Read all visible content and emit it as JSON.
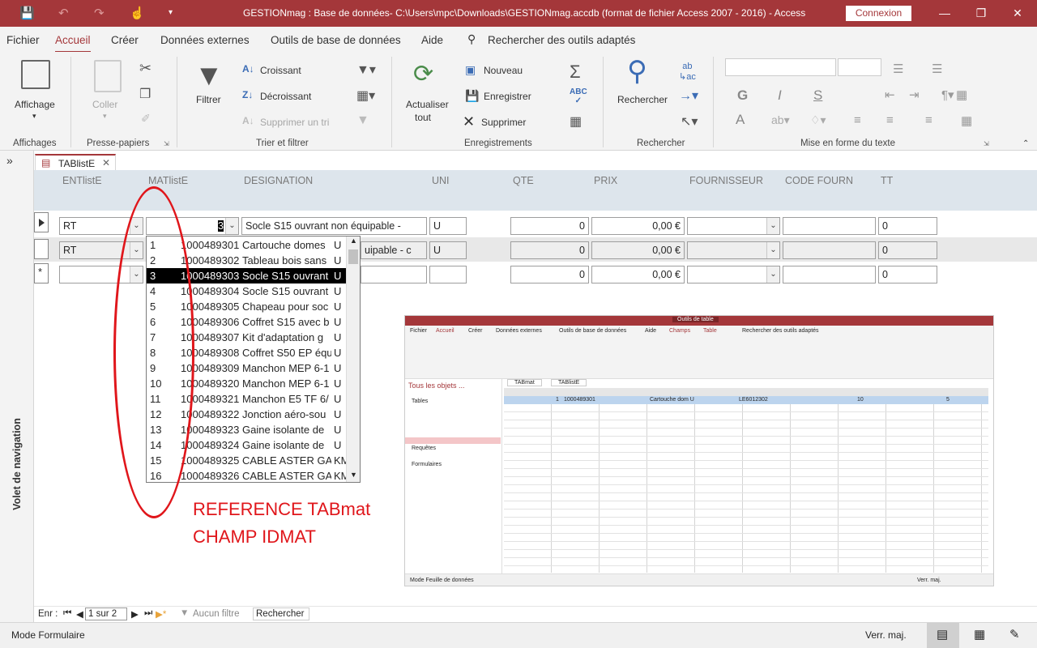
{
  "window": {
    "title": "GESTIONmag : Base de données- C:\\Users\\mpc\\Downloads\\GESTIONmag.accdb (format de fichier Access 2007 - 2016)  -  Access",
    "connexion": "Connexion"
  },
  "menu": [
    "Fichier",
    "Accueil",
    "Créer",
    "Données externes",
    "Outils de base de données",
    "Aide"
  ],
  "search_tools": "Rechercher des outils adaptés",
  "ribbon": {
    "affichage": "Affichage",
    "coller": "Coller",
    "filtrer": "Filtrer",
    "croissant": "Croissant",
    "decroissant": "Décroissant",
    "supprimer_tri": "Supprimer un tri",
    "actualiser": "Actualiser",
    "tout": "tout",
    "nouveau": "Nouveau",
    "enregistrer": "Enregistrer",
    "supprimer": "Supprimer",
    "rechercher": "Rechercher",
    "g": "G",
    "i": "I",
    "s": "S",
    "a": "A",
    "groups": {
      "affichages": "Affichages",
      "presse_papiers": "Presse-papiers",
      "trier_filtrer": "Trier et filtrer",
      "enregistrements": "Enregistrements",
      "rechercher": "Rechercher",
      "mise_en_forme": "Mise en forme du texte"
    }
  },
  "nav_pane_label": "Volet de navigation",
  "tab": {
    "label": "TABlistE"
  },
  "columns": [
    "ENTlistE",
    "MATlistE",
    "DESIGNATION",
    "UNI",
    "QTE",
    "PRIX",
    "FOURNISSEUR",
    "CODE FOURN",
    "TT"
  ],
  "rows": [
    {
      "ent": "RT",
      "mat": "3",
      "designation": "Socle S15 ouvrant non équipable -",
      "uni": "U",
      "qte": "0",
      "prix": "0,00 €",
      "fournisseur": "",
      "code": "",
      "tt": "0"
    },
    {
      "ent": "RT",
      "mat": "",
      "designation": "uipable - c",
      "uni": "U",
      "qte": "0",
      "prix": "0,00 €",
      "fournisseur": "",
      "code": "",
      "tt": "0"
    },
    {
      "ent": "",
      "mat": "",
      "designation": "",
      "uni": "",
      "qte": "0",
      "prix": "0,00 €",
      "fournisseur": "",
      "code": "",
      "tt": "0"
    }
  ],
  "dropdown_items": [
    {
      "n": "1",
      "code": "1000489301",
      "label": "Cartouche domes",
      "u": "U"
    },
    {
      "n": "2",
      "code": "1000489302",
      "label": "Tableau bois sans",
      "u": "U"
    },
    {
      "n": "3",
      "code": "1000489303",
      "label": "Socle S15 ouvrant",
      "u": "U"
    },
    {
      "n": "4",
      "code": "1000489304",
      "label": "Socle S15 ouvrant",
      "u": "U"
    },
    {
      "n": "5",
      "code": "1000489305",
      "label": "Chapeau pour soc",
      "u": "U"
    },
    {
      "n": "6",
      "code": "1000489306",
      "label": "Coffret S15 avec b",
      "u": "U"
    },
    {
      "n": "7",
      "code": "1000489307",
      "label": "Kit d'adaptation g",
      "u": "U"
    },
    {
      "n": "8",
      "code": "1000489308",
      "label": "Coffret S50 EP équ",
      "u": "U"
    },
    {
      "n": "9",
      "code": "1000489309",
      "label": "Manchon MEP 6-1",
      "u": "U"
    },
    {
      "n": "10",
      "code": "1000489320",
      "label": "Manchon MEP 6-1",
      "u": "U"
    },
    {
      "n": "11",
      "code": "1000489321",
      "label": "Manchon E5 TF 6/",
      "u": "U"
    },
    {
      "n": "12",
      "code": "1000489322",
      "label": "Jonction aéro-sou",
      "u": "U"
    },
    {
      "n": "13",
      "code": "1000489323",
      "label": "Gaine isolante de",
      "u": "U"
    },
    {
      "n": "14",
      "code": "1000489324",
      "label": "Gaine isolante de",
      "u": "U"
    },
    {
      "n": "15",
      "code": "1000489325",
      "label": "CABLE ASTER GAIN",
      "u": "KM"
    },
    {
      "n": "16",
      "code": "1000489326",
      "label": "CABLE ASTER GAIN",
      "u": "KM"
    }
  ],
  "annotation": {
    "line1": "REFERENCE TABmat",
    "line2": "CHAMP IDMAT"
  },
  "record_nav": {
    "prefix": "Enr :",
    "position": "1 sur 2",
    "filter": "Aucun filtre",
    "search": "Rechercher"
  },
  "status": {
    "mode": "Mode Formulaire",
    "caps": "Verr. maj."
  },
  "embedded_screenshot": {
    "menu": [
      "Fichier",
      "Accueil",
      "Créer",
      "Données externes",
      "Outils de base de données",
      "Aide",
      "Champs",
      "Table"
    ],
    "search": "Rechercher des outils adaptés",
    "context_tab": "Outils de table",
    "nav_title": "Tous les objets ...",
    "nav_sections": [
      "Tables",
      "Requêtes",
      "Formulaires"
    ],
    "tabs": [
      "TABmat",
      "TABlistE"
    ],
    "first_row": {
      "id": "1",
      "code": "1000489301",
      "label": "Cartouche dom U",
      "ref": "LE6012302",
      "qty": "10",
      "tt": "5"
    },
    "status_left": "Mode Feuille de données",
    "status_right": "Verr. maj."
  },
  "colors": {
    "brand": "#a4373a",
    "annotation": "#e0161b"
  }
}
